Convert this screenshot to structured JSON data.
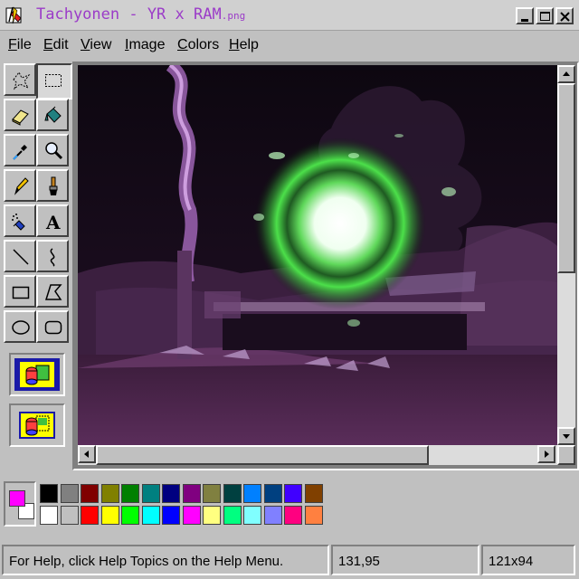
{
  "window": {
    "title": "Tachyonen - YR x RAM",
    "title_ext": ".png",
    "icons": [
      "paint-app-icon",
      "minimize-icon",
      "maximize-icon",
      "close-icon"
    ]
  },
  "menu": {
    "items": [
      {
        "underline": "F",
        "rest": "ile"
      },
      {
        "underline": "E",
        "rest": "dit"
      },
      {
        "underline": "V",
        "rest": "iew"
      },
      {
        "underline": "I",
        "rest": "mage"
      },
      {
        "underline": "C",
        "rest": "olors"
      },
      {
        "underline": "H",
        "rest": "elp"
      }
    ]
  },
  "tools": [
    "free-form-select",
    "rectangle-select",
    "eraser",
    "fill-with-color",
    "pick-color",
    "magnifier",
    "pencil",
    "brush",
    "airbrush",
    "text",
    "line",
    "curve",
    "rectangle",
    "polygon",
    "ellipse",
    "rounded-rectangle"
  ],
  "active_tool": "rectangle-select",
  "colors": {
    "foreground": "#ff00ff",
    "background": "#ffffff",
    "palette_top": [
      "#000000",
      "#808080",
      "#800000",
      "#808000",
      "#008000",
      "#008080",
      "#000080",
      "#800080",
      "#808040",
      "#004040",
      "#0080ff",
      "#004080",
      "#4000ff",
      "#804000"
    ],
    "palette_bottom": [
      "#ffffff",
      "#c0c0c0",
      "#ff0000",
      "#ffff00",
      "#00ff00",
      "#00ffff",
      "#0000ff",
      "#ff00ff",
      "#ffff80",
      "#00ff80",
      "#80ffff",
      "#8080ff",
      "#ff0080",
      "#ff8040"
    ]
  },
  "status": {
    "help": "For Help, click Help Topics on the Help Menu.",
    "cursor": "131,95",
    "size": "121x94"
  }
}
